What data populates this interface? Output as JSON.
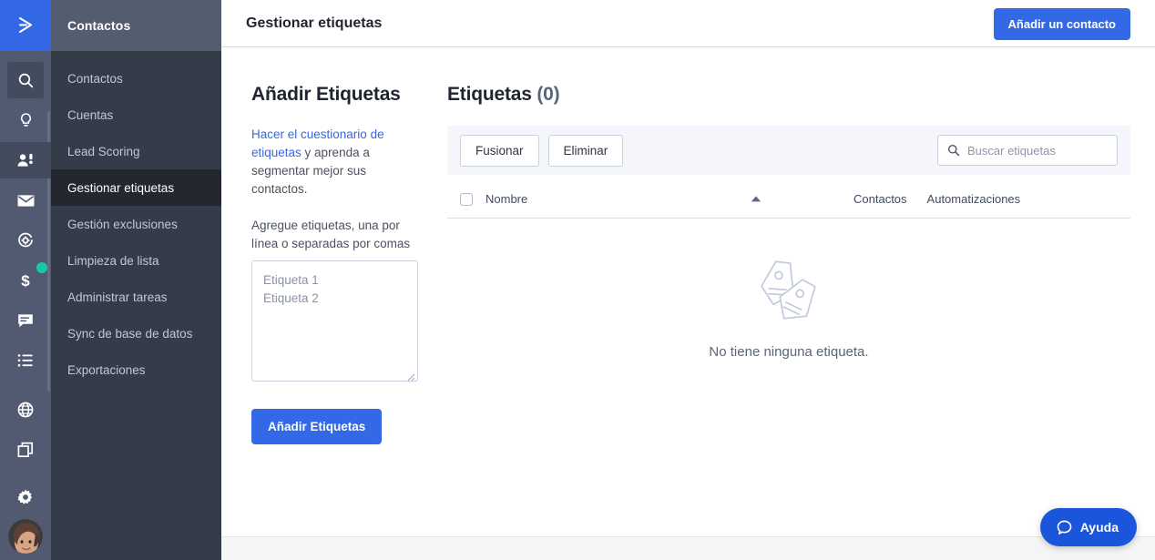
{
  "brand": {
    "logo_icon": "chevron-right-logo",
    "accent": "#3369e7"
  },
  "rail": {
    "items": [
      {
        "icon": "search-icon",
        "name": "search"
      },
      {
        "icon": "lightbulb-icon",
        "name": "ideas"
      },
      {
        "icon": "contacts-icon",
        "name": "contacts"
      },
      {
        "icon": "envelope-icon",
        "name": "campaigns"
      },
      {
        "icon": "automation-icon",
        "name": "automations"
      },
      {
        "icon": "dollar-icon",
        "name": "deals"
      },
      {
        "icon": "chat-icon",
        "name": "conversations"
      },
      {
        "icon": "list-icon",
        "name": "lists"
      },
      {
        "icon": "globe-icon",
        "name": "website"
      },
      {
        "icon": "pages-icon",
        "name": "pages"
      },
      {
        "icon": "gear-icon",
        "name": "settings"
      }
    ],
    "avatar_name": "user-avatar",
    "badge_color": "#19c9a2"
  },
  "sidebar": {
    "header_title": "Contactos",
    "items": [
      {
        "label": "Contactos",
        "active": false
      },
      {
        "label": "Cuentas",
        "active": false
      },
      {
        "label": "Lead Scoring",
        "active": false
      },
      {
        "label": "Gestionar etiquetas",
        "active": true
      },
      {
        "label": "Gestión exclusiones",
        "active": false
      },
      {
        "label": "Limpieza de lista",
        "active": false
      },
      {
        "label": "Administrar tareas",
        "active": false
      },
      {
        "label": "Sync de base de datos",
        "active": false
      },
      {
        "label": "Exportaciones",
        "active": false
      }
    ]
  },
  "topbar": {
    "title": "Gestionar etiquetas",
    "add_contact_label": "Añadir un contacto"
  },
  "add_panel": {
    "heading": "Añadir Etiquetas",
    "intro_link": "Hacer el cuestionario de etiquetas",
    "intro_rest": " y aprenda a segmentar mejor sus contactos.",
    "textarea_label": "Agregue etiquetas, una por línea o separadas por comas",
    "textarea_placeholder": "Etiqueta 1\nEtiqueta 2",
    "textarea_value": "",
    "submit_label": "Añadir Etiquetas"
  },
  "tags_panel": {
    "heading": "Etiquetas",
    "count": "(0)",
    "merge_label": "Fusionar",
    "delete_label": "Eliminar",
    "search_placeholder": "Buscar etiquetas",
    "search_value": "",
    "columns": {
      "name": "Nombre",
      "contacts": "Contactos",
      "automations": "Automatizaciones"
    },
    "sort_direction": "asc",
    "empty_message": "No tiene ninguna etiqueta.",
    "empty_icon": "tags-illustration",
    "rows": []
  },
  "help_widget": {
    "label": "Ayuda",
    "icon": "chat-bubble-icon",
    "color": "#1a56db"
  }
}
